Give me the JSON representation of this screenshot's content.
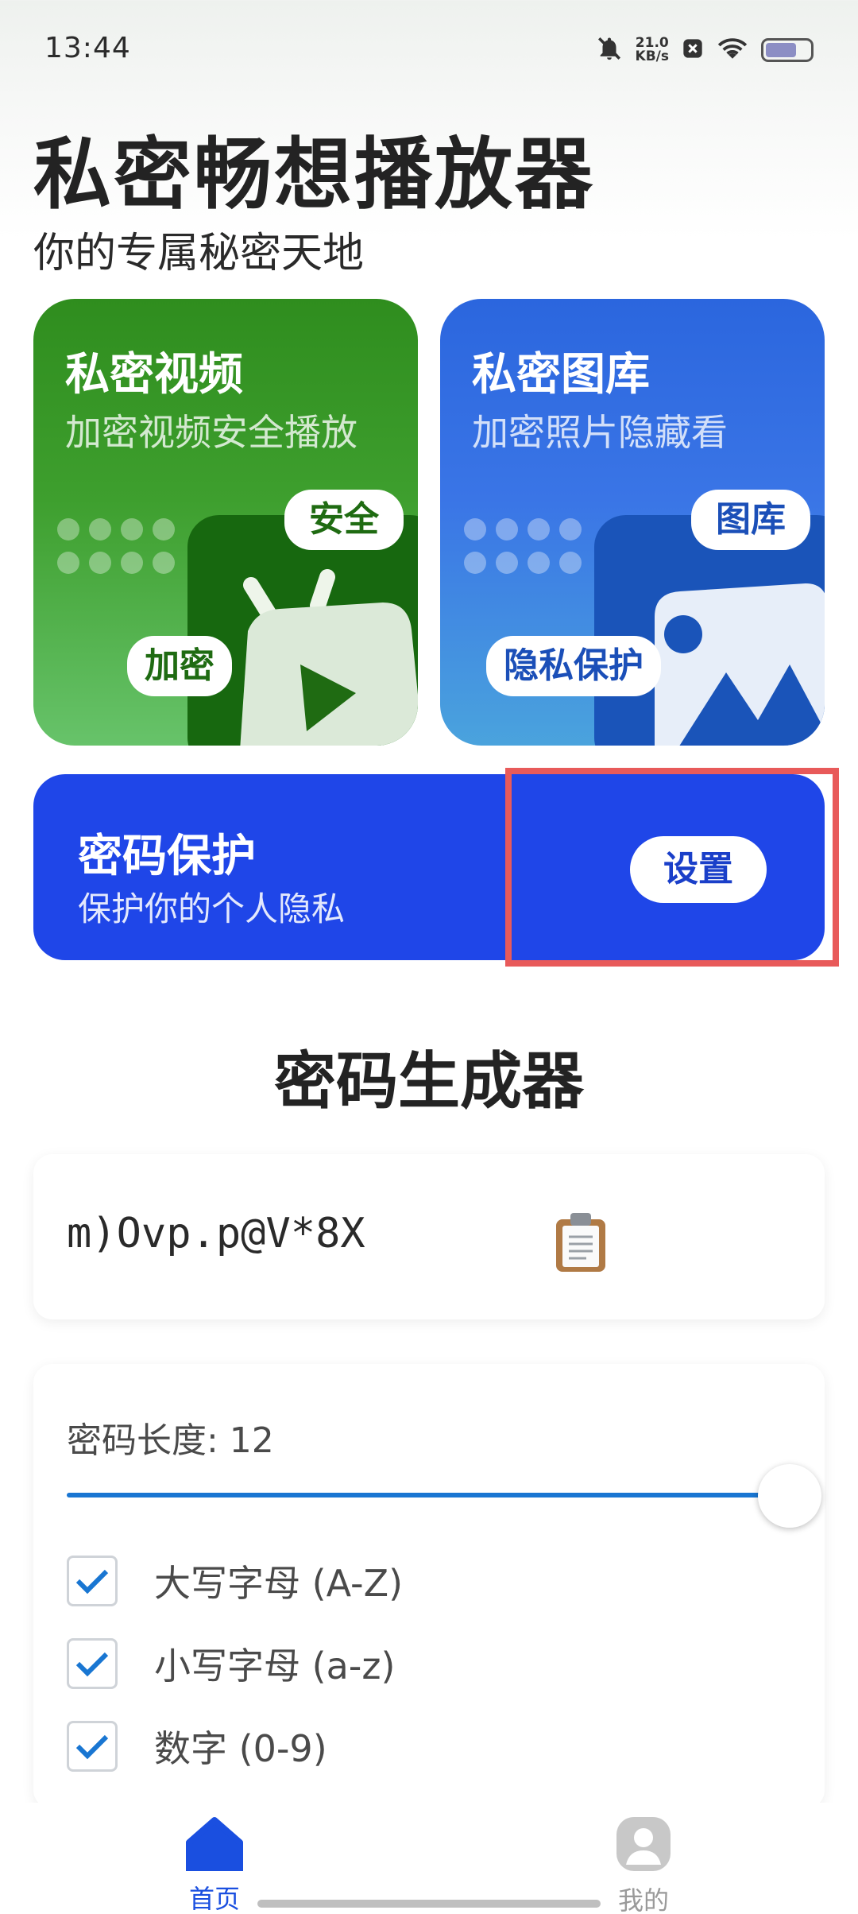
{
  "status_bar": {
    "time": "13:44",
    "net_speed_value": "21.0",
    "net_speed_unit": "KB/s",
    "icons": [
      "bell-mute-icon",
      "app-notification-icon",
      "wifi-icon",
      "battery-icon"
    ],
    "battery_level": 0.7
  },
  "header": {
    "title": "私密畅想播放器",
    "subtitle": "你的专属秘密天地"
  },
  "cards": {
    "video": {
      "title": "私密视频",
      "desc": "加密视频安全播放",
      "badge_top": "安全",
      "badge_low": "加密",
      "icon": "tv-play-icon",
      "color": "#3e9f2e"
    },
    "gallery": {
      "title": "私密图库",
      "desc": "加密照片隐藏看",
      "badge_top": "图库",
      "badge_low": "隐私保护",
      "icon": "image-icon",
      "color": "#3a75e6"
    }
  },
  "protect": {
    "title": "密码保护",
    "desc": "保护你的个人隐私",
    "button": "设置",
    "color": "#1f46e8"
  },
  "generator": {
    "title": "密码生成器",
    "password": "m)Ovp.p@V*8X",
    "copy_icon": "clipboard-icon",
    "length_label": "密码长度: 12",
    "slider_value": 1.0,
    "options": [
      {
        "label": "大写字母 (A-Z)",
        "checked": true
      },
      {
        "label": "小写字母 (a-z)",
        "checked": true
      },
      {
        "label": "数字 (0-9)",
        "checked": true
      }
    ]
  },
  "nav": {
    "items": [
      {
        "label": "首页",
        "icon": "home-icon",
        "active": true
      },
      {
        "label": "我的",
        "icon": "profile-icon",
        "active": false
      }
    ],
    "accent": "#1a4fe0"
  }
}
